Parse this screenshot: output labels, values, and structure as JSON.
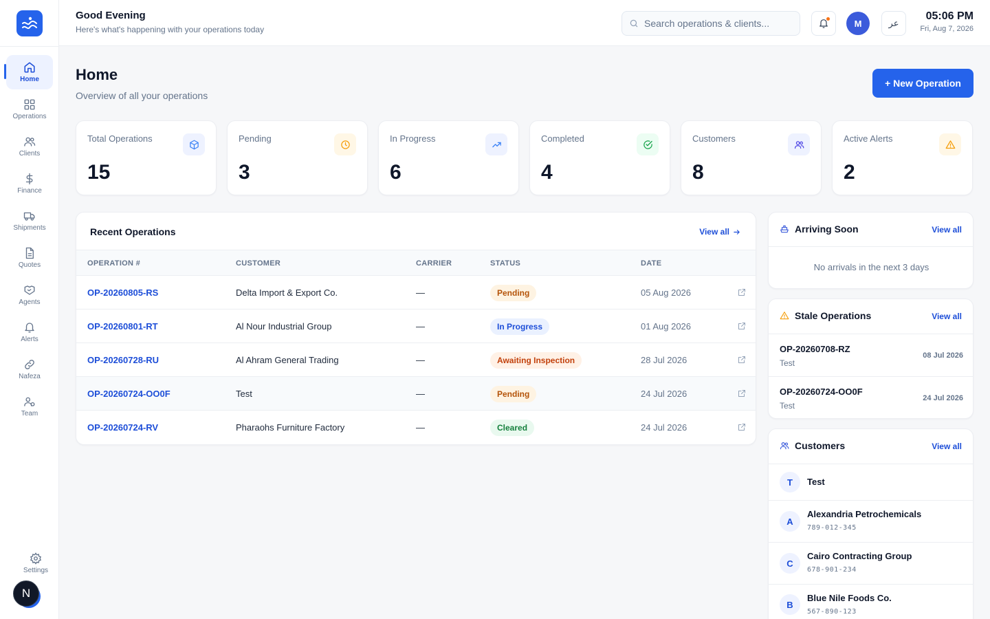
{
  "sidebar": {
    "items": [
      {
        "label": "Home",
        "icon": "home-icon",
        "active": true
      },
      {
        "label": "Operations",
        "icon": "grid-icon"
      },
      {
        "label": "Clients",
        "icon": "users-icon"
      },
      {
        "label": "Finance",
        "icon": "dollar-icon"
      },
      {
        "label": "Shipments",
        "icon": "truck-icon"
      },
      {
        "label": "Quotes",
        "icon": "document-icon"
      },
      {
        "label": "Agents",
        "icon": "handshake-icon"
      },
      {
        "label": "Alerts",
        "icon": "bell-icon"
      },
      {
        "label": "Nafeza",
        "icon": "link-icon"
      },
      {
        "label": "Team",
        "icon": "team-icon"
      }
    ],
    "settings_label": "Settings",
    "next_badge": "N"
  },
  "header": {
    "greeting": "Good Evening",
    "subtitle": "Here's what's happening with your operations today",
    "search_placeholder": "Search operations & clients...",
    "avatar_initial": "M",
    "lang_label": "عر",
    "time": "05:06 PM",
    "date": "Fri, Aug 7, 2026"
  },
  "page": {
    "title": "Home",
    "subtitle": "Overview of all your operations",
    "new_operation_label": "+ New Operation"
  },
  "stats": [
    {
      "label": "Total Operations",
      "value": "15",
      "icon": "box-icon",
      "color": "#3b82f6",
      "bg": "#eef2ff"
    },
    {
      "label": "Pending",
      "value": "3",
      "icon": "clock-icon",
      "color": "#f59e0b",
      "bg": "#fff7e6"
    },
    {
      "label": "In Progress",
      "value": "6",
      "icon": "trending-up-icon",
      "color": "#3b82f6",
      "bg": "#eef2ff"
    },
    {
      "label": "Completed",
      "value": "4",
      "icon": "check-circle-icon",
      "color": "#16a34a",
      "bg": "#ecfdf3"
    },
    {
      "label": "Customers",
      "value": "8",
      "icon": "users-icon",
      "color": "#4f46e5",
      "bg": "#eef2ff"
    },
    {
      "label": "Active Alerts",
      "value": "2",
      "icon": "warning-icon",
      "color": "#f59e0b",
      "bg": "#fff7e6"
    }
  ],
  "recent": {
    "title": "Recent Operations",
    "view_all": "View all",
    "columns": [
      "OPERATION #",
      "CUSTOMER",
      "CARRIER",
      "STATUS",
      "DATE"
    ],
    "rows": [
      {
        "op": "OP-20260805-RS",
        "customer": "Delta Import & Export Co.",
        "carrier": "—",
        "status": "Pending",
        "date": "05 Aug 2026"
      },
      {
        "op": "OP-20260801-RT",
        "customer": "Al Nour Industrial Group",
        "carrier": "—",
        "status": "In Progress",
        "date": "01 Aug 2026"
      },
      {
        "op": "OP-20260728-RU",
        "customer": "Al Ahram General Trading",
        "carrier": "—",
        "status": "Awaiting Inspection",
        "date": "28 Jul 2026"
      },
      {
        "op": "OP-20260724-OO0F",
        "customer": "Test",
        "carrier": "—",
        "status": "Pending",
        "date": "24 Jul 2026"
      },
      {
        "op": "OP-20260724-RV",
        "customer": "Pharaohs Furniture Factory",
        "carrier": "—",
        "status": "Cleared",
        "date": "24 Jul 2026"
      }
    ],
    "status_colors": {
      "Pending": {
        "fg": "#b45309",
        "bg": "#fef3e2"
      },
      "In Progress": {
        "fg": "#1d4ed8",
        "bg": "#eaf1ff"
      },
      "Awaiting Inspection": {
        "fg": "#c2410c",
        "bg": "#fff1e6"
      },
      "Cleared": {
        "fg": "#15803d",
        "bg": "#e9f9ef"
      }
    }
  },
  "arriving": {
    "title": "Arriving Soon",
    "view_all": "View all",
    "empty": "No arrivals in the next 3 days"
  },
  "stale": {
    "title": "Stale Operations",
    "view_all": "View all",
    "items": [
      {
        "op": "OP-20260708-RZ",
        "customer": "Test",
        "date": "08 Jul 2026"
      },
      {
        "op": "OP-20260724-OO0F",
        "customer": "Test",
        "date": "24 Jul 2026"
      }
    ]
  },
  "customers": {
    "title": "Customers",
    "view_all": "View all",
    "items": [
      {
        "initial": "T",
        "name": "Test",
        "phone": ""
      },
      {
        "initial": "A",
        "name": "Alexandria Petrochemicals",
        "phone": "789-012-345"
      },
      {
        "initial": "C",
        "name": "Cairo Contracting Group",
        "phone": "678-901-234"
      },
      {
        "initial": "B",
        "name": "Blue Nile Foods Co.",
        "phone": "567-890-123"
      }
    ]
  }
}
